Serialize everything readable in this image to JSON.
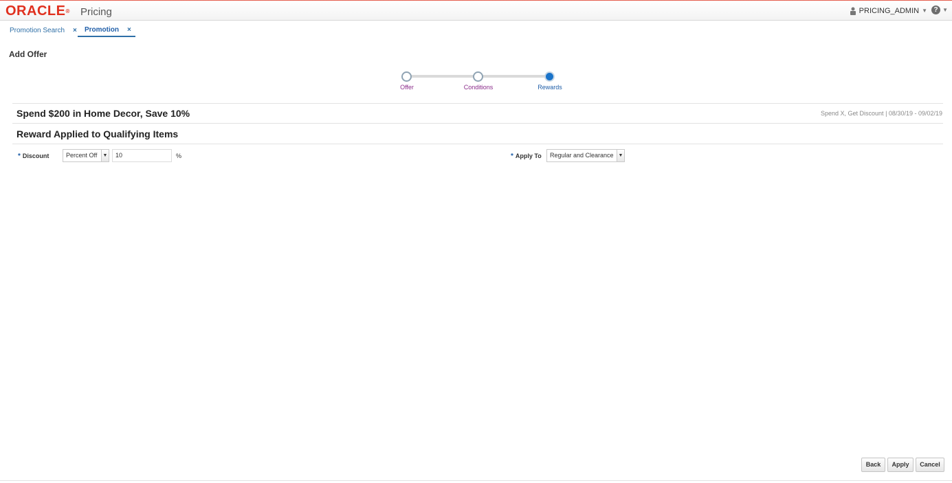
{
  "header": {
    "logo": "ORACLE",
    "logo_mark": "®",
    "app_title": "Pricing",
    "user": "PRICING_ADMIN",
    "user_icon": "user-icon",
    "help_icon": "help-icon"
  },
  "tabs": [
    {
      "label": "Promotion Search",
      "close": "×",
      "active": false
    },
    {
      "label": "Promotion",
      "close": "×",
      "active": true
    }
  ],
  "page": {
    "title": "Add Offer"
  },
  "train": {
    "steps": [
      {
        "label": "Offer",
        "state": "visited"
      },
      {
        "label": "Conditions",
        "state": "visited"
      },
      {
        "label": "Rewards",
        "state": "current"
      }
    ]
  },
  "offer": {
    "title": "Spend $200 in Home Decor, Save 10%",
    "type": "Spend X, Get Discount",
    "separator": "|",
    "dates": "08/30/19 - 09/02/19"
  },
  "section": {
    "title": "Reward Applied to Qualifying Items"
  },
  "form": {
    "required_mark": "*",
    "discount_label": "Discount",
    "discount_type": "Percent Off",
    "discount_value": "10",
    "discount_unit": "%",
    "apply_to_label": "Apply To",
    "apply_to_value": "Regular and Clearance"
  },
  "buttons": {
    "back": "Back",
    "apply": "Apply",
    "cancel": "Cancel"
  },
  "colors": {
    "brand": "#e0301e",
    "link": "#2e6fa7",
    "visited_step": "#8a2b8a",
    "current_step": "#1a73c9"
  }
}
